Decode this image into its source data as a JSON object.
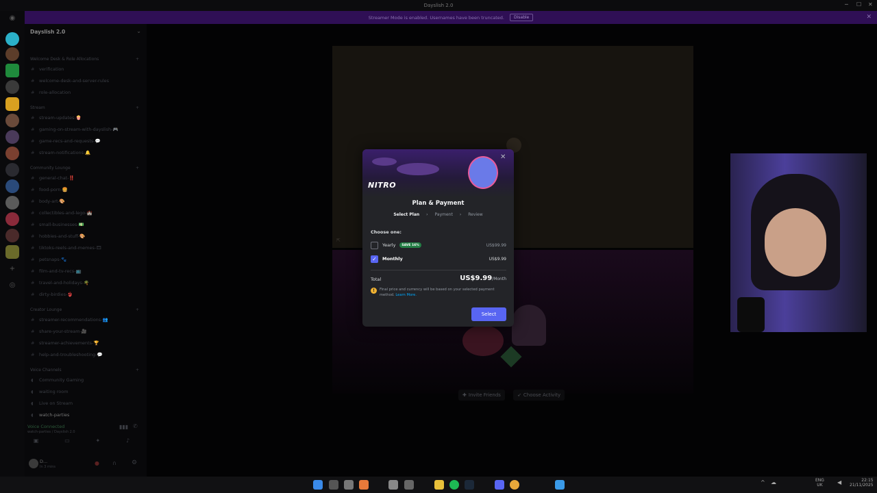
{
  "window": {
    "title": "Dayslish 2.0"
  },
  "banner": {
    "text": "Streamer Mode is enabled. Usernames have been truncated.",
    "button": "Disable"
  },
  "sidebar": {
    "server_name": "Dayslish 2.0",
    "categories": [
      {
        "name": "Welcome Desk & Role Allocations",
        "channels": [
          "verification",
          "welcome-desk-and-server-rules",
          "role-allocation"
        ]
      },
      {
        "name": "Stream",
        "channels": [
          "stream-updates-🍿",
          "gaming-on-stream-with-dayslish-🎮",
          "game-recs-and-requests-💬",
          "stream-notifications-🔔"
        ]
      },
      {
        "name": "Community Lounge",
        "channels": [
          "general-chat-‼️",
          "food-porn-🍔",
          "body-art-🎨",
          "collectibles-and-lego-🏰",
          "small-businesses-💵",
          "hobbies-and-stuff-🎨",
          "tiktoks-reels-and-memes-🎞",
          "petsnaps-🐾",
          "film-and-tv-recs-📺",
          "travel-and-holidays-🌴",
          "dirty-birdies-👙"
        ]
      },
      {
        "name": "Creator Lounge",
        "channels": [
          "streamer-recommendations-👥",
          "share-your-stream-🎥",
          "streamer-achievements-🏆",
          "help-and-troubleshooting-💬"
        ]
      },
      {
        "name": "Voice Channels",
        "voice": [
          "Community Gaming",
          "waiting room",
          "Live on Stream"
        ],
        "active": "watch-parties"
      }
    ],
    "voice_connected": {
      "status": "Voice Connected",
      "detail": "watch-parties / Dayslish 2.0"
    },
    "user": {
      "name": "D...",
      "status": "In 3 mins"
    }
  },
  "main": {
    "buttons": {
      "invite": "Invite Friends",
      "activity": "Choose Activity"
    }
  },
  "modal": {
    "logo": "NITRO",
    "title": "Plan & Payment",
    "steps": [
      "Select Plan",
      "Payment",
      "Review"
    ],
    "choose_label": "Choose one:",
    "plans": [
      {
        "name": "Yearly",
        "badge": "SAVE 16%",
        "price": "US$99.99",
        "selected": false
      },
      {
        "name": "Monthly",
        "badge": "",
        "price": "US$9.99",
        "selected": true
      }
    ],
    "total_label": "Total",
    "total_value": "US$9.99",
    "total_period": "/Month",
    "note": "Final price and currency will be based on your selected payment method.",
    "learn_more": "Learn More.",
    "select_button": "Select"
  },
  "taskbar": {
    "language": "ENG",
    "region": "UK",
    "time": "22:15",
    "date": "21/11/2025"
  },
  "colors": {
    "blurple": "#5865f2",
    "save_badge": "#248046",
    "banner": "#2f0f55"
  }
}
